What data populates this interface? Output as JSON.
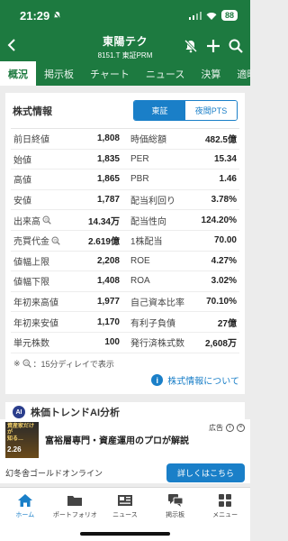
{
  "status": {
    "time": "21:29",
    "battery": "88"
  },
  "header": {
    "stock_name": "東陽テク",
    "stock_code": "8151.T 東証PRM"
  },
  "tabs": [
    {
      "label": "概況",
      "active": true
    },
    {
      "label": "掲示板"
    },
    {
      "label": "チャート"
    },
    {
      "label": "ニュース"
    },
    {
      "label": "決算"
    },
    {
      "label": "適時"
    }
  ],
  "info": {
    "title": "株式情報",
    "segments": [
      "東証",
      "夜間PTS"
    ],
    "rows": [
      {
        "l_label": "前日終値",
        "l_value": "1,808",
        "r_label": "時価総額",
        "r_value": "482.5億"
      },
      {
        "l_label": "始値",
        "l_value": "1,835",
        "r_label": "PER",
        "r_value": "15.34"
      },
      {
        "l_label": "高値",
        "l_value": "1,865",
        "r_label": "PBR",
        "r_value": "1.46"
      },
      {
        "l_label": "安値",
        "l_value": "1,787",
        "r_label": "配当利回り",
        "r_value": "3.78%"
      },
      {
        "l_label": "出来高",
        "l_value": "14.34万",
        "r_label": "配当性向",
        "r_value": "124.20%"
      },
      {
        "l_label": "売買代金",
        "l_value": "2.619億",
        "r_label": "1株配当",
        "r_value": "70.00"
      },
      {
        "l_label": "値幅上限",
        "l_value": "2,208",
        "r_label": "ROE",
        "r_value": "4.27%"
      },
      {
        "l_label": "値幅下限",
        "l_value": "1,408",
        "r_label": "ROA",
        "r_value": "3.02%"
      },
      {
        "l_label": "年初来高値",
        "l_value": "1,977",
        "r_label": "自己資本比率",
        "r_value": "70.10%"
      },
      {
        "l_label": "年初来安値",
        "l_value": "1,170",
        "r_label": "有利子負債",
        "r_value": "27億"
      },
      {
        "l_label": "単元株数",
        "l_value": "100",
        "r_label": "発行済株式数",
        "r_value": "2,608万"
      }
    ],
    "note_prefix": "※",
    "note": "：15分ディレイで表示",
    "link": "株式情報について"
  },
  "ai": {
    "badge": "AI",
    "title": "株価トレンドAI分析"
  },
  "ad": {
    "label": "広告",
    "thumb_line1": "資産家だけが",
    "thumb_line2": "知る…",
    "thumb_big": "2.26",
    "headline": "富裕層専門・資産運用のプロが解説",
    "advertiser": "幻冬舎ゴールドオンライン",
    "cta": "詳しくはこちら"
  },
  "nav": [
    {
      "label": "ホーム",
      "icon": "home-icon",
      "active": true
    },
    {
      "label": "ポートフォリオ",
      "icon": "folder-icon"
    },
    {
      "label": "ニュース",
      "icon": "newspaper-icon"
    },
    {
      "label": "掲示板",
      "icon": "chat-icon"
    },
    {
      "label": "メニュー",
      "icon": "grid-icon"
    }
  ],
  "colors": {
    "brand_green": "#1d7a40",
    "accent_blue": "#1a7fc8"
  }
}
